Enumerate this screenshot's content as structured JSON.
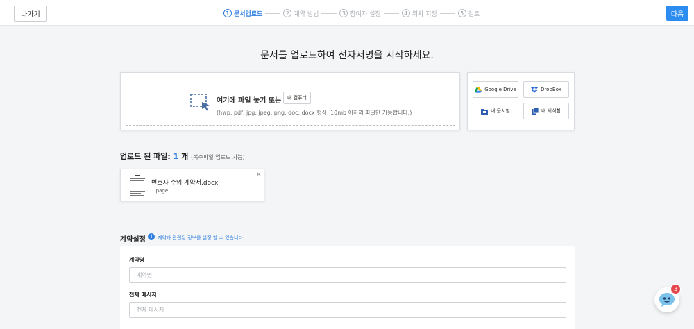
{
  "header": {
    "exit_label": "나가기",
    "next_label": "다음",
    "accent_color": "#2d8cf0",
    "steps": [
      {
        "num": "1",
        "label": "문서업로드",
        "active": true
      },
      {
        "num": "2",
        "label": "계약 방법",
        "active": false
      },
      {
        "num": "3",
        "label": "참여자 설정",
        "active": false
      },
      {
        "num": "4",
        "label": "위치 지정",
        "active": false
      },
      {
        "num": "5",
        "label": "검토",
        "active": false
      }
    ]
  },
  "main": {
    "headline": "문서를 업로드하여 전자서명을 시작하세요.",
    "dropzone": {
      "title": "여기에 파일 놓기 또는",
      "pc_button": "내 컴퓨터",
      "subtitle": "(hwp, pdf, jpg, jpeg, png, doc, docx 형식, 10mb 이하의 파일만 가능합니다.)"
    },
    "sources": {
      "google_drive": "Google Drive",
      "dropbox": "DropBox",
      "my_documents": "내 문서함",
      "my_forms": "내 서식함"
    },
    "uploaded": {
      "label": "업로드 된 파일:",
      "count": "1",
      "unit": "개",
      "note": "(복수파일 업로드 가능)",
      "files": [
        {
          "name": "변호사 수임 계약서.docx",
          "pages": "1 page"
        }
      ]
    },
    "settings": {
      "title": "계약설정",
      "hint": "계약과 관련된 정보를 설정 할 수 있습니다.",
      "contract_name_label": "계약명",
      "contract_name_placeholder": "계약명",
      "message_label": "전체 메시지",
      "message_placeholder": "전체 메시지"
    }
  },
  "chat": {
    "badge": "3"
  }
}
